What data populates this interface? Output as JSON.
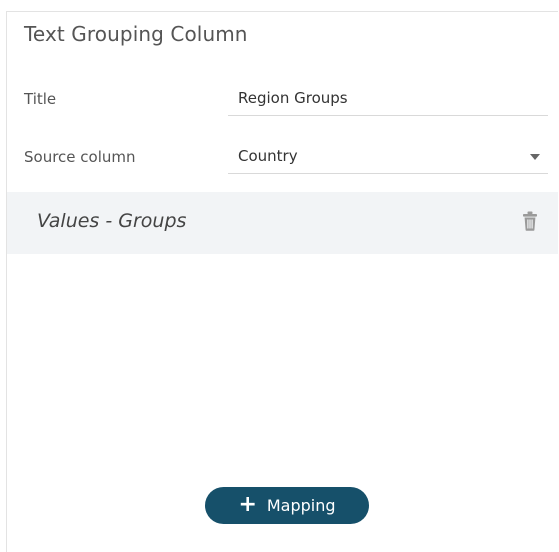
{
  "panel": {
    "title": "Text Grouping Column"
  },
  "fields": {
    "title_label": "Title",
    "title_value": "Region Groups",
    "source_label": "Source column",
    "source_value": "Country"
  },
  "group": {
    "title": "Values - Groups",
    "delete_icon": "trash-icon"
  },
  "actions": {
    "mapping_label": "Mapping",
    "mapping_icon": "plus-icon"
  },
  "colors": {
    "accent": "#16506a",
    "group_bg": "#f2f4f6"
  }
}
